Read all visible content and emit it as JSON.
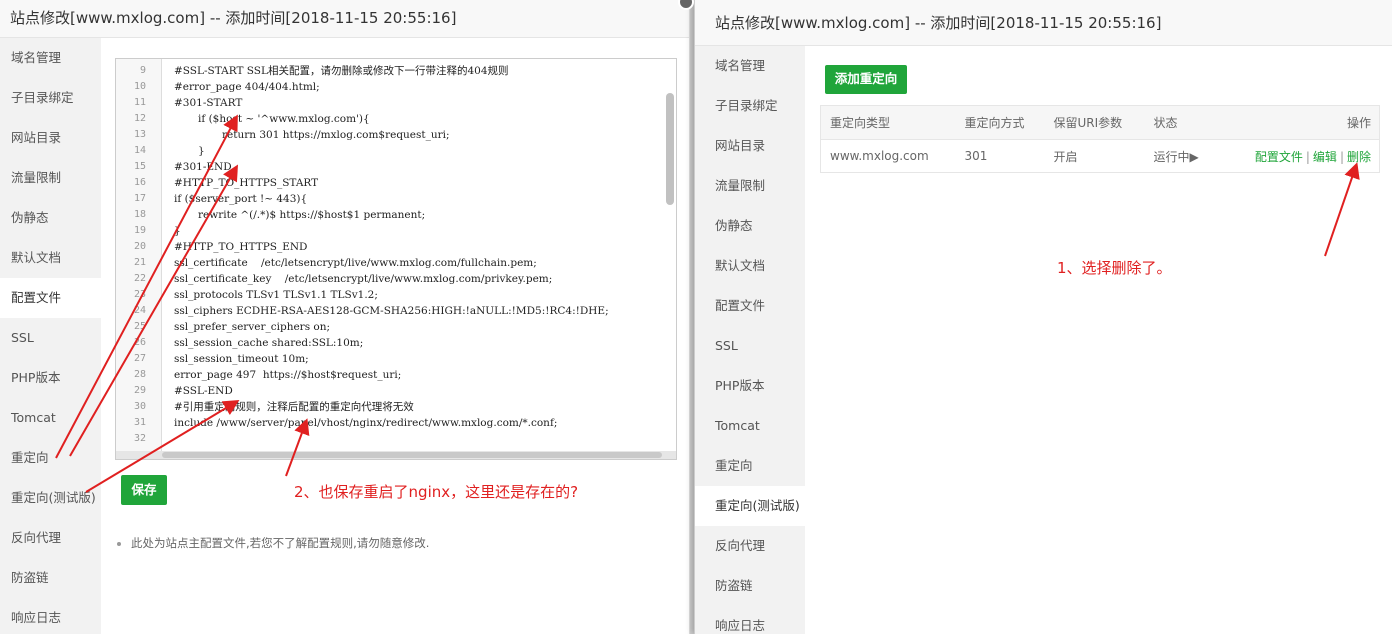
{
  "left": {
    "title": "站点修改[www.mxlog.com] -- 添加时间[2018-11-15 20:55:16]",
    "sidebar": [
      "域名管理",
      "子目录绑定",
      "网站目录",
      "流量限制",
      "伪静态",
      "默认文档",
      "配置文件",
      "SSL",
      "PHP版本",
      "Tomcat",
      "重定向",
      "重定向(测试版)",
      "反向代理",
      "防盗链",
      "响应日志"
    ],
    "active_index": 6,
    "code_lines": [
      {
        "n": "9",
        "t": "#SSL-START SSL相关配置，请勿删除或修改下一行带注释的404规则",
        "indent": 0
      },
      {
        "n": "10",
        "t": "#error_page 404/404.html;",
        "indent": 0
      },
      {
        "n": "11",
        "t": "#301-START",
        "indent": 0
      },
      {
        "n": "12",
        "t": "if ($host ~ '^www.mxlog.com'){",
        "indent": 1
      },
      {
        "n": "13",
        "t": "return 301 https://mxlog.com$request_uri;",
        "indent": 2
      },
      {
        "n": "14",
        "t": "}",
        "indent": 1
      },
      {
        "n": "15",
        "t": "#301-END",
        "indent": 0
      },
      {
        "n": "16",
        "t": "#HTTP_TO_HTTPS_START",
        "indent": 0
      },
      {
        "n": "17",
        "t": "if ($server_port !~ 443){",
        "indent": 0
      },
      {
        "n": "18",
        "t": "rewrite ^(/.*)$ https://$host$1 permanent;",
        "indent": 1
      },
      {
        "n": "19",
        "t": "}",
        "indent": 0
      },
      {
        "n": "20",
        "t": "#HTTP_TO_HTTPS_END",
        "indent": 0
      },
      {
        "n": "21",
        "t": "ssl_certificate    /etc/letsencrypt/live/www.mxlog.com/fullchain.pem;",
        "indent": 0
      },
      {
        "n": "22",
        "t": "ssl_certificate_key    /etc/letsencrypt/live/www.mxlog.com/privkey.pem;",
        "indent": 0
      },
      {
        "n": "23",
        "t": "ssl_protocols TLSv1 TLSv1.1 TLSv1.2;",
        "indent": 0
      },
      {
        "n": "24",
        "t": "ssl_ciphers ECDHE-RSA-AES128-GCM-SHA256:HIGH:!aNULL:!MD5:!RC4:!DHE;",
        "indent": 0
      },
      {
        "n": "25",
        "t": "ssl_prefer_server_ciphers on;",
        "indent": 0
      },
      {
        "n": "26",
        "t": "ssl_session_cache shared:SSL:10m;",
        "indent": 0
      },
      {
        "n": "27",
        "t": "ssl_session_timeout 10m;",
        "indent": 0
      },
      {
        "n": "28",
        "t": "error_page 497  https://$host$request_uri;",
        "indent": 0
      },
      {
        "n": "29",
        "t": "#SSL-END",
        "indent": 0
      },
      {
        "n": "30",
        "t": "#引用重定向规则，注释后配置的重定向代理将无效",
        "indent": 0
      },
      {
        "n": "31",
        "t": "include /www/server/panel/vhost/nginx/redirect/www.mxlog.com/*.conf;",
        "indent": 0
      },
      {
        "n": "32",
        "t": "",
        "indent": 0
      }
    ],
    "save_label": "保存",
    "tip": "此处为站点主配置文件,若您不了解配置规则,请勿随意修改.",
    "annotation": "2、也保存重启了nginx，这里还是存在的?"
  },
  "right": {
    "title": "站点修改[www.mxlog.com] -- 添加时间[2018-11-15 20:55:16]",
    "sidebar": [
      "域名管理",
      "子目录绑定",
      "网站目录",
      "流量限制",
      "伪静态",
      "默认文档",
      "配置文件",
      "SSL",
      "PHP版本",
      "Tomcat",
      "重定向",
      "重定向(测试版)",
      "反向代理",
      "防盗链",
      "响应日志"
    ],
    "active_index": 11,
    "add_label": "添加重定向",
    "table": {
      "headers": [
        "重定向类型",
        "重定向方式",
        "保留URI参数",
        "状态",
        "操作"
      ],
      "row": {
        "type": "www.mxlog.com",
        "method": "301",
        "keep_uri": "开启",
        "status": "运行中▶",
        "ops": [
          "配置文件",
          "编辑",
          "删除"
        ],
        "sep": "|"
      }
    },
    "annotation": "1、选择删除了。"
  },
  "colors": {
    "accent": "#20a53a",
    "annotation": "#e02020"
  }
}
